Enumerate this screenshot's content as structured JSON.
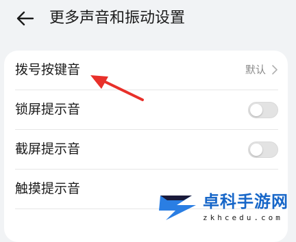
{
  "header": {
    "title": "更多声音和振动设置",
    "back_icon": "arrow-left-icon"
  },
  "settings": {
    "dial_tone": {
      "label": "拨号按键音",
      "value": "默认"
    },
    "lock_sound": {
      "label": "锁屏提示音",
      "enabled": false
    },
    "screenshot_sound": {
      "label": "截屏提示音",
      "enabled": false
    },
    "touch_sound": {
      "label": "触摸提示音"
    }
  },
  "annotation": {
    "type": "red-arrow",
    "color": "#e8302a"
  },
  "watermark": {
    "text": "卓科手游网",
    "url": "zkhcedu.com",
    "color": "#1666c8"
  },
  "colors": {
    "background": "#f1f3f5",
    "card": "#ffffff",
    "toggle_off": "#e3e3e3"
  }
}
